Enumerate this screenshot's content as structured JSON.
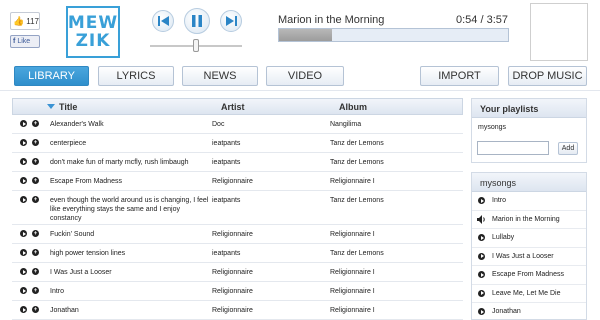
{
  "facebook": {
    "like_count": "117",
    "like_label": "Like"
  },
  "logo": {
    "line1": "MEW",
    "line2": "ZIK"
  },
  "player": {
    "now_playing": "Marion in the Morning",
    "time": "0:54 / 3:57",
    "progress_fraction": 0.23,
    "volume_fraction": 0.5
  },
  "tabs": {
    "library": "LIBRARY",
    "lyrics": "LYRICS",
    "news": "NEWS",
    "video": "VIDEO",
    "import": "IMPORT",
    "drop_music": "DROP MUSIC"
  },
  "table": {
    "headers": {
      "title": "Title",
      "artist": "Artist",
      "album": "Album"
    },
    "rows": [
      {
        "title": "Alexander's Walk",
        "artist": "Doc",
        "album": "Nangilima"
      },
      {
        "title": "centerpiece",
        "artist": "ieatpants",
        "album": "Tanz der Lemons"
      },
      {
        "title": "don't make fun of marty mcfly, rush limbaugh",
        "artist": "ieatpants",
        "album": "Tanz der Lemons"
      },
      {
        "title": "Escape From Madness",
        "artist": "Religionnaire",
        "album": "Religionnaire I"
      },
      {
        "title": "even though the world around us is changing, I feel like everything stays the same and I enjoy constancy",
        "artist": "ieatpants",
        "album": "Tanz der Lemons"
      },
      {
        "title": "Fuckin' Sound",
        "artist": "Religionnaire",
        "album": "Religionnaire I"
      },
      {
        "title": "high power tension lines",
        "artist": "ieatpants",
        "album": "Tanz der Lemons"
      },
      {
        "title": "I Was Just a Looser",
        "artist": "Religionnaire",
        "album": "Religionnaire I"
      },
      {
        "title": "Intro",
        "artist": "Religionnaire",
        "album": "Religionnaire I"
      },
      {
        "title": "Jonathan",
        "artist": "Religionnaire",
        "album": "Religionnaire I"
      }
    ]
  },
  "playlists": {
    "header": "Your playlists",
    "items": [
      "mysongs"
    ],
    "add_label": "Add",
    "input_value": ""
  },
  "current_playlist": {
    "header": "mysongs",
    "playing_index": 1,
    "songs": [
      "Intro",
      "Marion in the Morning",
      "Lullaby",
      "I Was Just a Looser",
      "Escape From Madness",
      "Leave Me, Let Me Die",
      "Jonathan"
    ]
  },
  "colors": {
    "accent": "#39a0d8",
    "tab_active": "#3b9ad6"
  }
}
